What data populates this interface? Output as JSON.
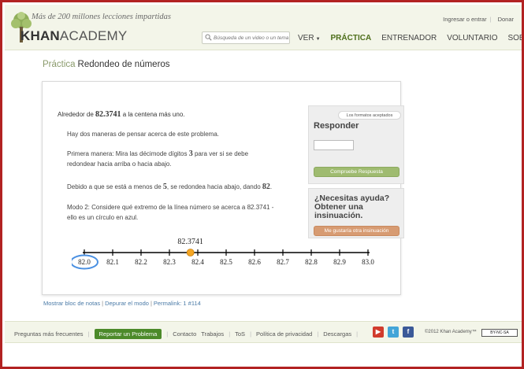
{
  "header": {
    "tagline": "Más de 200 millones lecciones impartidas",
    "brand_bold": "KHAN",
    "brand_rest": "ACADEMY",
    "search_placeholder": "Búsqueda de un video o un tema",
    "top_links": {
      "login": "Ingresar o entrar",
      "donate": "Donar"
    },
    "nav": [
      {
        "label": "VER",
        "has_caret": true,
        "active": false
      },
      {
        "label": "PRÁCTICA",
        "active": true
      },
      {
        "label": "ENTRENADOR",
        "active": false
      },
      {
        "label": "VOLUNTARIO",
        "active": false
      },
      {
        "label": "SOBRE",
        "active": false
      }
    ]
  },
  "page": {
    "breadcrumb": "Práctica",
    "title": "Redondeo de números"
  },
  "exercise": {
    "question_pre": "Alrededor de",
    "question_number": "82.3741",
    "question_post": "a la centena más uno.",
    "hints": [
      "Hay dos maneras de pensar acerca de este problema.",
      {
        "pre": "Primera manera: Mira las décimode dígitos",
        "num": "3",
        "post": "para ver si se debe",
        "line2": "redondear hacia arriba o hacia abajo."
      },
      {
        "pre": "Debido a que se está a menos de",
        "num": "5",
        "mid": ", se redondea hacia abajo, dando",
        "num2": "82",
        "post": "."
      },
      {
        "line1": "Modo 2: Considere qué extremo de la línea número se acerca a 82.3741 -",
        "line2": "ello es un círculo en azul."
      }
    ],
    "number_line": {
      "marker_label": "82.3741",
      "marker_value": 82.3741,
      "ticks": [
        "82.0",
        "82.1",
        "82.2",
        "82.3",
        "82.4",
        "82.5",
        "82.6",
        "82.7",
        "82.8",
        "82.9",
        "83.0"
      ],
      "circled": "82.0",
      "marker_color": "#f5a623",
      "circle_color": "#4a90e2"
    }
  },
  "answer": {
    "formats_label": "Los formatos aceptados",
    "title": "Responder",
    "input_value": "",
    "check_label": "Compruebe Respuesta"
  },
  "help": {
    "title": "¿Necesitas ayuda? Obtener una insinuación.",
    "hint_label": "Me gustaría otra insinuación"
  },
  "card_links": {
    "scratchpad": "Mostrar bloc de notas",
    "debug": "Depurar el modo",
    "permalink": "Permalink: 1 #114"
  },
  "footer": {
    "faq": "Preguntas más frecuentes",
    "report": "Reportar un Problema",
    "contact": "Contacto",
    "jobs": "Trabajos",
    "tos": "ToS",
    "privacy": "Política de privacidad",
    "downloads": "Descargas",
    "copyright": "©2012 Khan Academy™",
    "license": "BY-NC-SA",
    "social": [
      "youtube-icon",
      "twitter-icon",
      "facebook-icon"
    ]
  },
  "colors": {
    "frame": "#b22222",
    "nav_active": "#4d6e1a",
    "check_button": "#9fbb70",
    "hint_button": "#d79b72",
    "report_button": "#4c8a2a",
    "link": "#4a7aa7"
  }
}
